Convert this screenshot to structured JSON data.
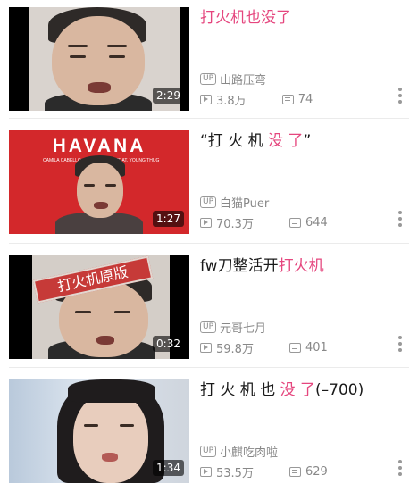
{
  "videos": [
    {
      "title_main": "打火机也没了",
      "title_hl": "",
      "title_tail": "",
      "duration": "2:29",
      "up_badge": "UP",
      "uploader": "山路压弯",
      "views": "3.8万",
      "danmaku": "74"
    },
    {
      "title_main": "“打 火 机 ",
      "title_hl": "没 了",
      "title_tail": "”",
      "duration": "1:27",
      "up_badge": "UP",
      "uploader": "白猫Puer",
      "views": "70.3万",
      "danmaku": "644",
      "thumb_text": "HAVANA",
      "thumb_sub_left": "CAMILA CABELLO",
      "thumb_sub_right": "FEAT. YOUNG THUG"
    },
    {
      "title_main": "fw刀整活开",
      "title_hl": "打火机",
      "title_tail": "",
      "duration": "0:32",
      "up_badge": "UP",
      "uploader": "元哥七月",
      "views": "59.8万",
      "danmaku": "401",
      "thumb_text": "打火机原版"
    },
    {
      "title_main": "打 火 机 也 ",
      "title_hl": "没 了",
      "title_tail": "(–700)",
      "duration": "1:34",
      "up_badge": "UP",
      "uploader": "小麒吃肉啦",
      "views": "53.5万",
      "danmaku": "629"
    }
  ],
  "colors": {
    "highlight": "#e5467e",
    "meta": "#888888"
  },
  "icons": {
    "views": "play-count-icon",
    "danmaku": "danmaku-icon",
    "more": "more-vertical-icon"
  }
}
